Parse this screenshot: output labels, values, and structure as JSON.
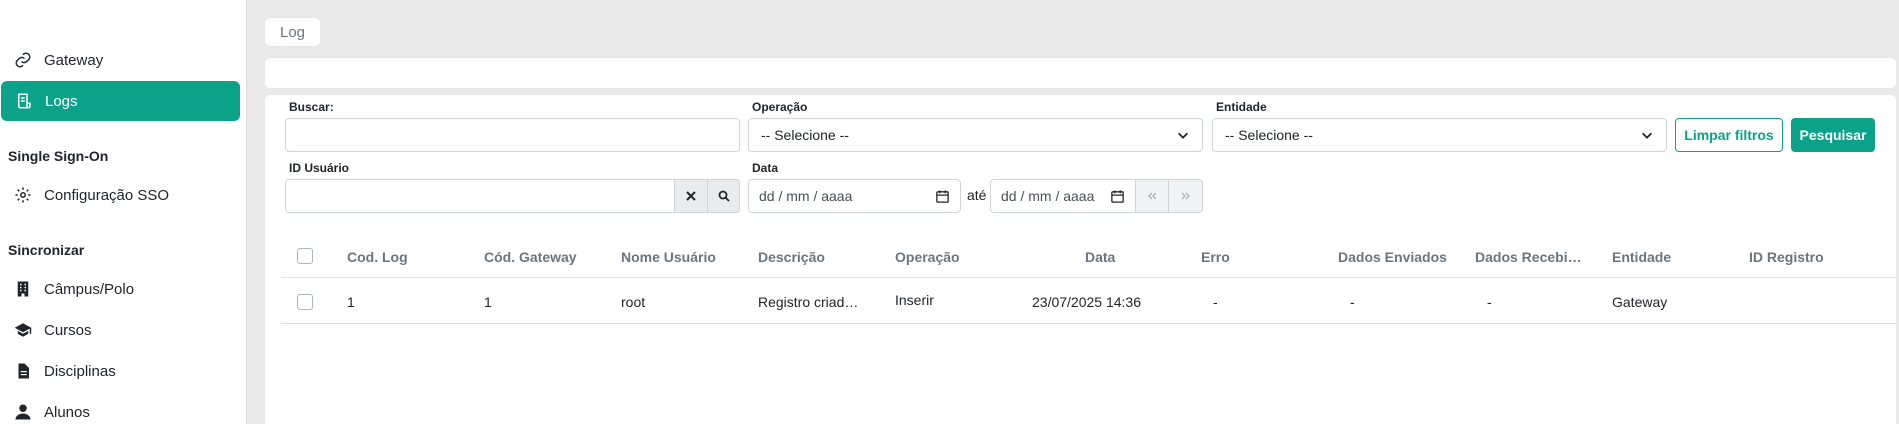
{
  "sidebar": {
    "items_top": [
      {
        "label": "Gateway",
        "icon": "link-icon"
      },
      {
        "label": "Logs",
        "icon": "log-icon",
        "active": true
      }
    ],
    "sso_section": {
      "title": "Single Sign-On",
      "items": [
        {
          "label": "Configuração SSO",
          "icon": "gear-icon"
        }
      ]
    },
    "sync_section": {
      "title": "Sincronizar",
      "items": [
        {
          "label": "Câmpus/Polo",
          "icon": "building-icon"
        },
        {
          "label": "Cursos",
          "icon": "graduation-cap-icon"
        },
        {
          "label": "Disciplinas",
          "icon": "file-icon"
        },
        {
          "label": "Alunos",
          "icon": "user-icon"
        }
      ]
    }
  },
  "breadcrumb": {
    "label": "Log"
  },
  "filters": {
    "buscar_label": "Buscar:",
    "buscar_value": "",
    "operacao_label": "Operação",
    "operacao_value": "-- Selecione --",
    "entidade_label": "Entidade",
    "entidade_value": "-- Selecione --",
    "limpar_label": "Limpar filtros",
    "pesquisar_label": "Pesquisar",
    "id_usuario_label": "ID Usuário",
    "id_usuario_value": "",
    "data_label": "Data",
    "date_from_placeholder": "dd / mm / aaaa",
    "ate_label": "até",
    "date_to_placeholder": "dd / mm / aaaa"
  },
  "table": {
    "columns": [
      "Cod. Log",
      "Cód. Gateway",
      "Nome Usuário",
      "Descrição",
      "Operação",
      "Data",
      "Erro",
      "Dados Enviados",
      "Dados Recebi…",
      "Entidade",
      "ID Registro"
    ],
    "rows": [
      [
        "1",
        "1",
        "root",
        "Registro criad…",
        "Inserir",
        "23/07/2025 14:36",
        "-",
        "-",
        "-",
        "Gateway",
        ""
      ]
    ]
  },
  "colors": {
    "accent": "#0aa38a",
    "background": "#e9e9e9"
  }
}
